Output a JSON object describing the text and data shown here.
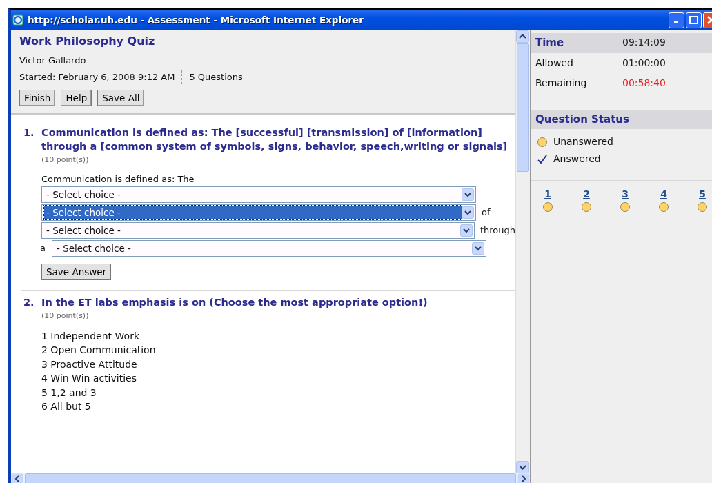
{
  "window": {
    "title": "http://scholar.uh.edu - Assessment - Microsoft Internet Explorer"
  },
  "quiz": {
    "title": "Work Philosophy Quiz",
    "student": "Victor Gallardo",
    "started": "Started: February 6, 2008 9:12 AM",
    "question_count": "5 Questions",
    "buttons": [
      "Finish",
      "Help",
      "Save All"
    ]
  },
  "questions": [
    {
      "kind": "dropdowns",
      "number": "1.",
      "text": "Communication is defined as: The [successful] [transmission] of [information] through a [common system of symbols, signs, behavior, speech,writing or signals]",
      "points": "(10 point(s))",
      "intro": "Communication is defined as: The",
      "blanks": [
        {
          "value": "- Select choice -",
          "selected": false
        },
        {
          "value": "- Select choice -",
          "selected": true,
          "suffix": "of"
        },
        {
          "value": "- Select choice -",
          "selected": false,
          "suffix": "through"
        },
        {
          "prefix": "a",
          "value": "- Select choice -",
          "selected": false
        }
      ],
      "save_button": "Save Answer"
    },
    {
      "kind": "list",
      "number": "2.",
      "text": "In the ET labs emphasis is on (Choose the most appropriate option!)",
      "points": "(10 point(s))",
      "options": [
        "1 Independent Work",
        "2 Open Communication",
        "3 Proactive Attitude",
        "4 Win Win activities",
        "5 1,2 and 3",
        "6 All but 5"
      ]
    }
  ],
  "timer": {
    "heading": "Time",
    "current": "09:14:09",
    "rows": [
      {
        "label": "Allowed",
        "value": "01:00:00",
        "kind": "normal"
      },
      {
        "label": "Remaining",
        "value": "00:58:40",
        "kind": "alert"
      }
    ]
  },
  "status": {
    "heading": "Question Status",
    "legend": [
      {
        "kind": "unanswered",
        "label": "Unanswered"
      },
      {
        "kind": "answered",
        "label": "Answered"
      }
    ],
    "questions": [
      {
        "label": "1",
        "answered": false
      },
      {
        "label": "2",
        "answered": false
      },
      {
        "label": "3",
        "answered": false
      },
      {
        "label": "4",
        "answered": false
      },
      {
        "label": "5",
        "answered": false
      }
    ]
  }
}
